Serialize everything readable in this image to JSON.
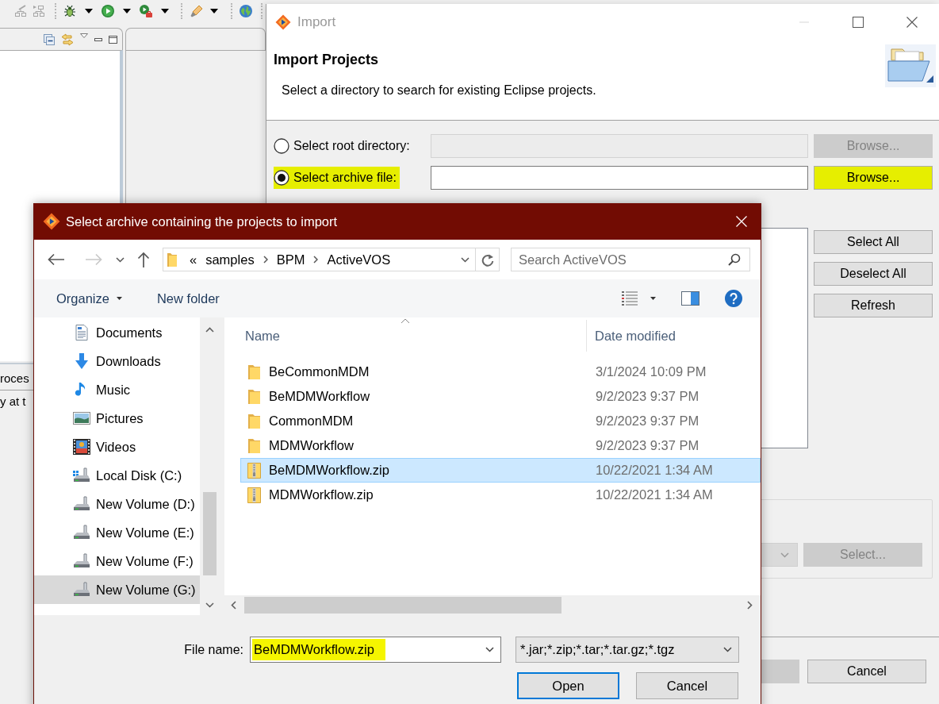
{
  "workbench": {
    "bottom_view": {
      "tab_label": "roces",
      "text": "y at t"
    }
  },
  "import_dialog": {
    "title": "Import",
    "heading": "Import Projects",
    "description": "Select a directory to search for existing Eclipse projects.",
    "sources": [
      {
        "label": "Select root directory:",
        "selected": false,
        "highlighted": false,
        "field": {
          "disabled": true
        },
        "browse_button": {
          "label": "Browse...",
          "disabled": true,
          "highlighted": false
        }
      },
      {
        "label": "Select archive file:",
        "selected": true,
        "highlighted": true,
        "field": {
          "disabled": false
        },
        "browse_button": {
          "label": "Browse...",
          "disabled": false,
          "highlighted": true
        }
      }
    ],
    "list_buttons": [
      {
        "label": "Select All"
      },
      {
        "label": "Deselect All"
      },
      {
        "label": "Refresh"
      }
    ],
    "working_set": {
      "dropdown": {
        "disabled": true
      },
      "select_button": {
        "label": "Select...",
        "disabled": true
      }
    },
    "footer_buttons": [
      {
        "disabled": true
      },
      {
        "label": "Cancel",
        "disabled": false
      }
    ]
  },
  "file_dialog": {
    "title": "Select archive containing the projects to import",
    "navigation": {
      "back": {
        "disabled": false
      },
      "forward": {
        "disabled": true
      }
    },
    "address": {
      "overflow": "«",
      "segments": [
        "samples",
        "BPM",
        "ActiveVOS"
      ]
    },
    "search": {
      "placeholder": "Search ActiveVOS"
    },
    "commands": [
      {
        "label": "Organize",
        "menu": true
      },
      {
        "label": "New folder",
        "menu": false
      }
    ],
    "sidebar": {
      "items": [
        {
          "label": "Documents",
          "kind": "documents",
          "selected": false
        },
        {
          "label": "Downloads",
          "kind": "downloads",
          "selected": false
        },
        {
          "label": "Music",
          "kind": "music",
          "selected": false
        },
        {
          "label": "Pictures",
          "kind": "pictures",
          "selected": false
        },
        {
          "label": "Videos",
          "kind": "videos",
          "selected": false
        },
        {
          "label": "Local Disk (C:)",
          "kind": "system_drive",
          "selected": false
        },
        {
          "label": "New Volume (D:)",
          "kind": "drive",
          "selected": false
        },
        {
          "label": "New Volume (E:)",
          "kind": "drive",
          "selected": false
        },
        {
          "label": "New Volume (F:)",
          "kind": "drive",
          "selected": false
        },
        {
          "label": "New Volume (G:)",
          "kind": "drive",
          "selected": true
        }
      ]
    },
    "files": {
      "columns": [
        {
          "label": "Name",
          "sorted": true
        },
        {
          "label": "Date modified",
          "sorted": false
        }
      ],
      "rows": [
        {
          "name": "BeCommonMDM",
          "date": "3/1/2024 10:09 PM",
          "kind": "folder",
          "selected": false
        },
        {
          "name": "BeMDMWorkflow",
          "date": "9/2/2023 9:37 PM",
          "kind": "folder",
          "selected": false
        },
        {
          "name": "CommonMDM",
          "date": "9/2/2023 9:37 PM",
          "kind": "folder",
          "selected": false
        },
        {
          "name": "MDMWorkflow",
          "date": "9/2/2023 9:37 PM",
          "kind": "folder",
          "selected": false
        },
        {
          "name": "BeMDMWorkflow.zip",
          "date": "10/22/2021 1:34 AM",
          "kind": "zip",
          "selected": true
        },
        {
          "name": "MDMWorkflow.zip",
          "date": "10/22/2021 1:34 AM",
          "kind": "zip",
          "selected": false
        }
      ]
    },
    "file_name": {
      "label": "File name:",
      "value": "BeMDMWorkflow.zip",
      "highlighted": true
    },
    "file_type": {
      "value": "*.jar;*.zip;*.tar;*.tar.gz;*.tgz"
    },
    "buttons": [
      {
        "label": "Open",
        "default": true
      },
      {
        "label": "Cancel",
        "default": false
      }
    ]
  }
}
